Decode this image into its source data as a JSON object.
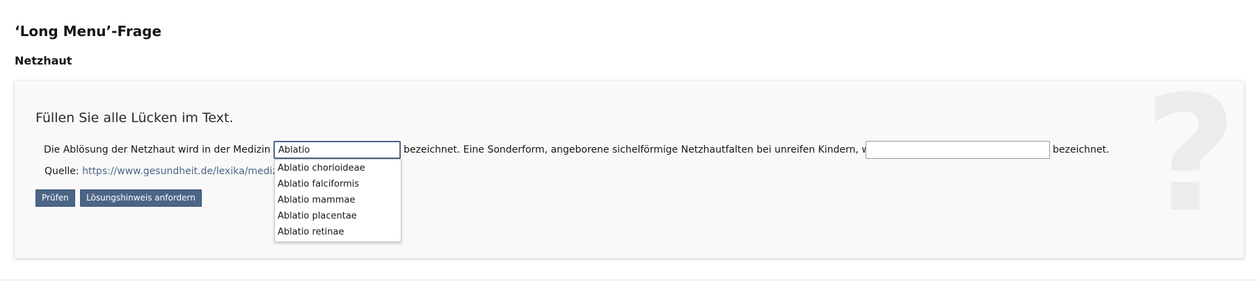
{
  "page": {
    "title": "‘Long Menu’-Frage"
  },
  "question": {
    "title": "Netzhaut",
    "instruction": "Füllen Sie alle Lücken im Text.",
    "text": {
      "part1": "Die Ablösung der Netzhaut wird in der Medizin als",
      "part2": "bezeichnet. Eine Sonderform, angeborene sichelförmige Netzhautfalten bei unreifen Kindern, wird als",
      "part3": "bezeichnet."
    },
    "gap1": {
      "value": "Ablatio",
      "placeholder": ""
    },
    "gap2": {
      "value": "",
      "placeholder": ""
    },
    "suggestions": [
      "Ablatio chorioideae",
      "Ablatio falciformis",
      "Ablatio mammae",
      "Ablatio placentae",
      "Ablatio retinae"
    ],
    "source": {
      "label": "Quelle:",
      "link_text": "https://www.gesundheit.de/lexika/medizin-"
    }
  },
  "buttons": {
    "check": "Prüfen",
    "hint": "Lösungshinweis anfordern"
  },
  "icons": {
    "background": "question-mark-icon"
  },
  "colors": {
    "button_bg": "#4c6586",
    "link": "#4c6586",
    "panel_bg": "#f9f9f9"
  }
}
